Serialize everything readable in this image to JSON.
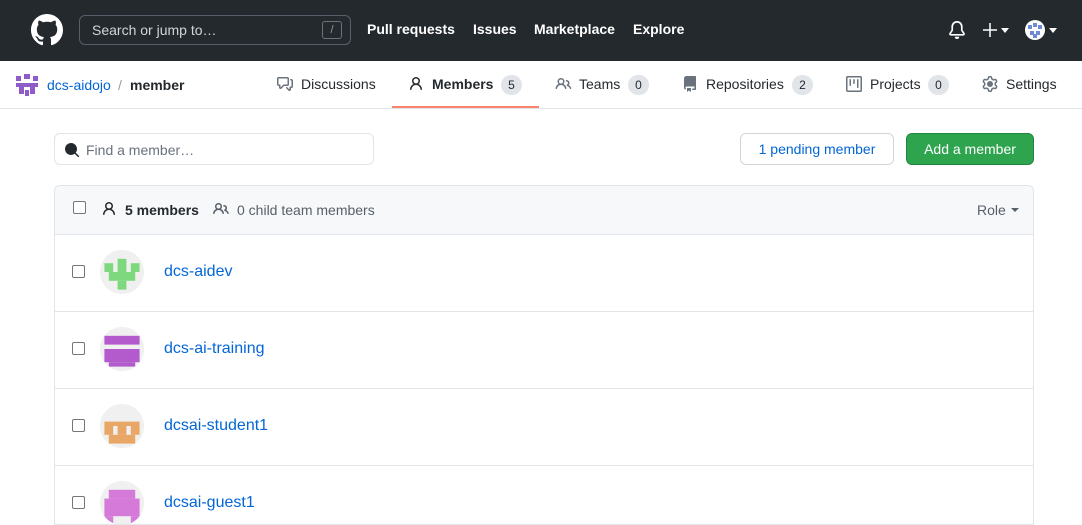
{
  "header": {
    "search_placeholder": "Search or jump to…",
    "search_shortcut": "/",
    "nav": [
      {
        "label": "Pull requests"
      },
      {
        "label": "Issues"
      },
      {
        "label": "Marketplace"
      },
      {
        "label": "Explore"
      }
    ]
  },
  "org": {
    "name": "dcs-aidojo",
    "separator": "/",
    "team": "member"
  },
  "tabs": [
    {
      "label": "Discussions",
      "icon": "comment-discussion-icon"
    },
    {
      "label": "Members",
      "count": "5",
      "icon": "person-icon",
      "active": true
    },
    {
      "label": "Teams",
      "count": "0",
      "icon": "people-icon"
    },
    {
      "label": "Repositories",
      "count": "2",
      "icon": "repo-icon"
    },
    {
      "label": "Projects",
      "count": "0",
      "icon": "project-icon"
    },
    {
      "label": "Settings",
      "icon": "gear-icon"
    }
  ],
  "toolbar": {
    "find_placeholder": "Find a member…",
    "pending_label": "1 pending member",
    "add_label": "Add a member"
  },
  "list": {
    "member_count": "5 members",
    "child_count": "0 child team members",
    "role_label": "Role"
  },
  "members": [
    {
      "name": "dcs-aidev",
      "avatar_color": "#7ed97e"
    },
    {
      "name": "dcs-ai-training",
      "avatar_color": "#b35bcc"
    },
    {
      "name": "dcsai-student1",
      "avatar_color": "#e8a766"
    },
    {
      "name": "dcsai-guest1",
      "avatar_color": "#d57ad9"
    }
  ],
  "colors": {
    "header_bg": "#24292e",
    "link": "#0366d6",
    "primary_button": "#2ea44f",
    "active_tab_underline": "#f9826c"
  }
}
